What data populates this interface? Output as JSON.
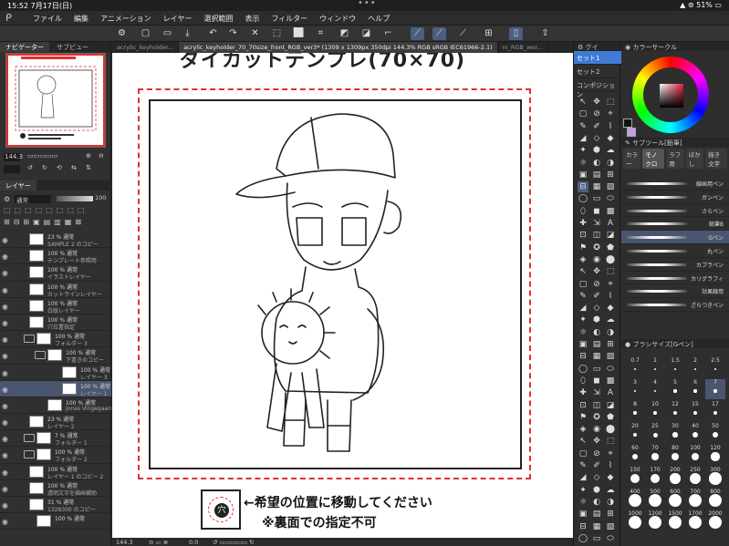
{
  "status_bar": {
    "time": "15:52",
    "date": "7月17日(日)",
    "dots": "•••",
    "battery": "51%"
  },
  "menu": {
    "items": [
      "ファイル",
      "編集",
      "アニメーション",
      "レイヤー",
      "選択範囲",
      "表示",
      "フィルター",
      "ウィンドウ",
      "ヘルプ"
    ]
  },
  "left_panel": {
    "tabs": [
      "ナビゲーター",
      "サブビュー"
    ],
    "navigator_zoom": "144.3",
    "layer_tab": "レイヤー",
    "blend_mode": "通常",
    "opacity": "100"
  },
  "layers": [
    {
      "opacity": "23 % 通常",
      "name": "SAMPLE 2 のコピー"
    },
    {
      "opacity": "100 % 通常",
      "name": "テンプレート参照用"
    },
    {
      "opacity": "100 % 通常",
      "name": "イラストレイヤー"
    },
    {
      "opacity": "100 % 通常",
      "name": "カットラインレイヤー"
    },
    {
      "opacity": "100 % 通常",
      "name": "白版レイヤー"
    },
    {
      "opacity": "100 % 通常",
      "name": "穴位置指定"
    },
    {
      "opacity": "100 % 通常",
      "name": "フォルダー 3",
      "folder": true
    },
    {
      "opacity": "100 % 通常",
      "name": "下書きのコピー",
      "folder": true
    },
    {
      "opacity": "100 % 通常",
      "name": "レイヤー 3"
    },
    {
      "opacity": "100 % 通常",
      "name": "レイヤー 1",
      "selected": true
    },
    {
      "opacity": "100 % 通常",
      "name": "Jonas Vingegaard"
    },
    {
      "opacity": "23 % 通常",
      "name": "レイヤー 2"
    },
    {
      "opacity": "7 % 通常",
      "name": "フォルダー 1",
      "folder": true
    },
    {
      "opacity": "100 % 通常",
      "name": "フォルダー 2",
      "folder": true
    },
    {
      "opacity": "100 % 通常",
      "name": "レイヤー 1 のコピー 2"
    },
    {
      "opacity": "100 % 通常",
      "name": "透明文字を描画補助"
    },
    {
      "opacity": "31 % 通常",
      "name": "1328300 のコピー"
    },
    {
      "opacity": "100 % 通常",
      "name": ""
    }
  ],
  "doc_tabs": [
    "acrylic_keyholder...",
    "acrylic_keyholder_70_70size_front_RGB_ver3* (1309 x 1309px 350dpi 144.3% RGB sRGB IEC61966-2.1)",
    "ni_RGB_wor..."
  ],
  "canvas": {
    "title": "ダイカットテンプレ(70×70)",
    "hole_glyph": "穴",
    "note_line1": "←希望の位置に移動してください",
    "note_line2": "※裏面での指定不可",
    "status_zoom": "144.3",
    "status_angle": "0.0"
  },
  "tool_sets": [
    "セット1",
    "セット2",
    "コンポジション"
  ],
  "tool_panel_label": "クイ",
  "color_panel": {
    "title": "カラーサークル",
    "fg_color": "#111111",
    "bg_color": "#c89ae8"
  },
  "subtool": {
    "title": "サブツール[鉛筆]",
    "tabs": [
      "カラー",
      "モノクロ",
      "ラフ用",
      "ぼかし",
      "描き文字"
    ]
  },
  "brushes": [
    "線画用ペン",
    "ガンペン",
    "さらペン",
    "鉛筆B",
    "Gペン",
    "丸ペン",
    "カブラペン",
    "カリグラフィ",
    "効果線用",
    "ざらつきペン"
  ],
  "selected_brush": "Gペン",
  "brush_size": {
    "title": "ブラシサイズ[Gペン]",
    "sizes": [
      "0.7",
      "1",
      "1.5",
      "2",
      "2.5",
      "3",
      "4",
      "5",
      "6",
      "7",
      "8",
      "10",
      "12",
      "15",
      "17",
      "20",
      "25",
      "30",
      "40",
      "50",
      "60",
      "70",
      "80",
      "100",
      "120",
      "150",
      "170",
      "200",
      "250",
      "300",
      "400",
      "500",
      "600",
      "700",
      "800",
      "1000",
      "1200",
      "1500",
      "1700",
      "2000"
    ],
    "selected": "7"
  },
  "colors": {
    "accent": "#3f7ad6",
    "selection": "#4a5670",
    "guide_red": "#e03030"
  }
}
